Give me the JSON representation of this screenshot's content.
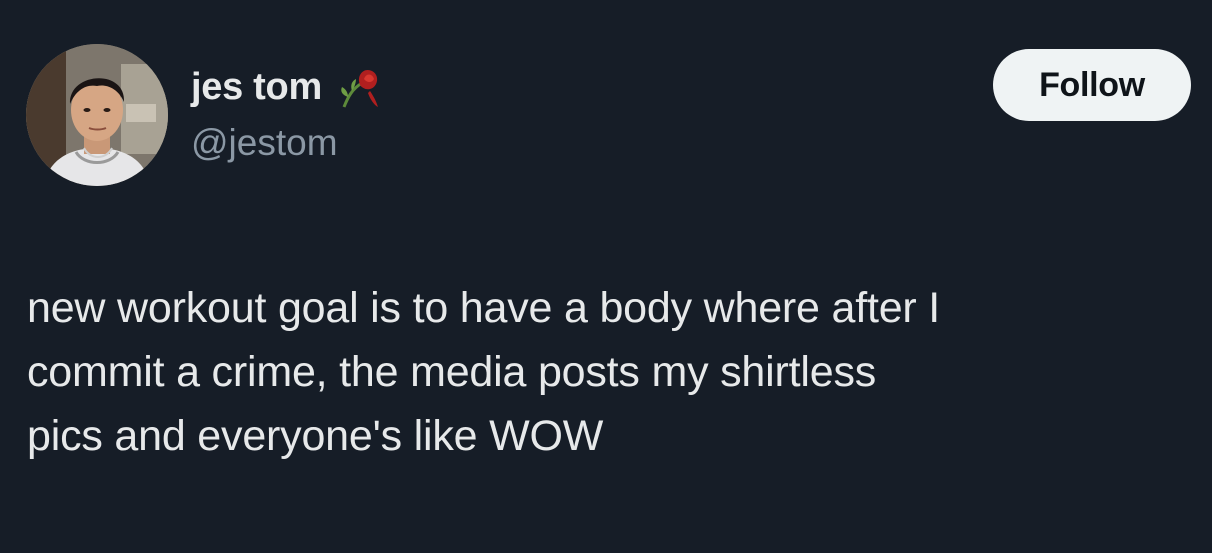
{
  "author": {
    "display_name": "jes tom",
    "handle": "@jestom",
    "name_emoji": "wilted-rose-icon"
  },
  "actions": {
    "follow_label": "Follow"
  },
  "tweet": {
    "lines": [
      "new workout goal is to have a body where after I",
      "commit a crime, the media posts my shirtless",
      "pics and everyone's like WOW"
    ]
  },
  "colors": {
    "background": "#161d27",
    "text_primary": "#e7e9ea",
    "text_secondary": "#8b98a5",
    "follow_bg": "#eff3f4",
    "follow_text": "#0f1419"
  }
}
